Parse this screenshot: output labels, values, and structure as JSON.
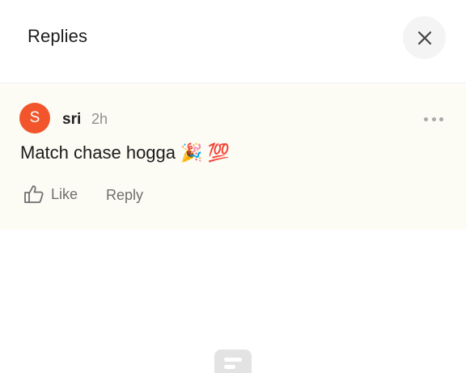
{
  "header": {
    "title": "Replies",
    "close_icon": "close-icon"
  },
  "reply": {
    "avatar_initial": "S",
    "avatar_color": "#f2552c",
    "username": "sri",
    "time": "2h",
    "text": "Match chase hogga 🎉 💯",
    "more_icon": "more-horizontal-icon",
    "like_label": "Like",
    "like_icon": "thumbs-up-icon",
    "reply_label": "Reply"
  },
  "footer": {
    "icon": "empty-state-icon"
  },
  "colors": {
    "card_background": "#fcfbf4",
    "secondary_text": "#6f6f6f",
    "accent": "#f2552c"
  }
}
